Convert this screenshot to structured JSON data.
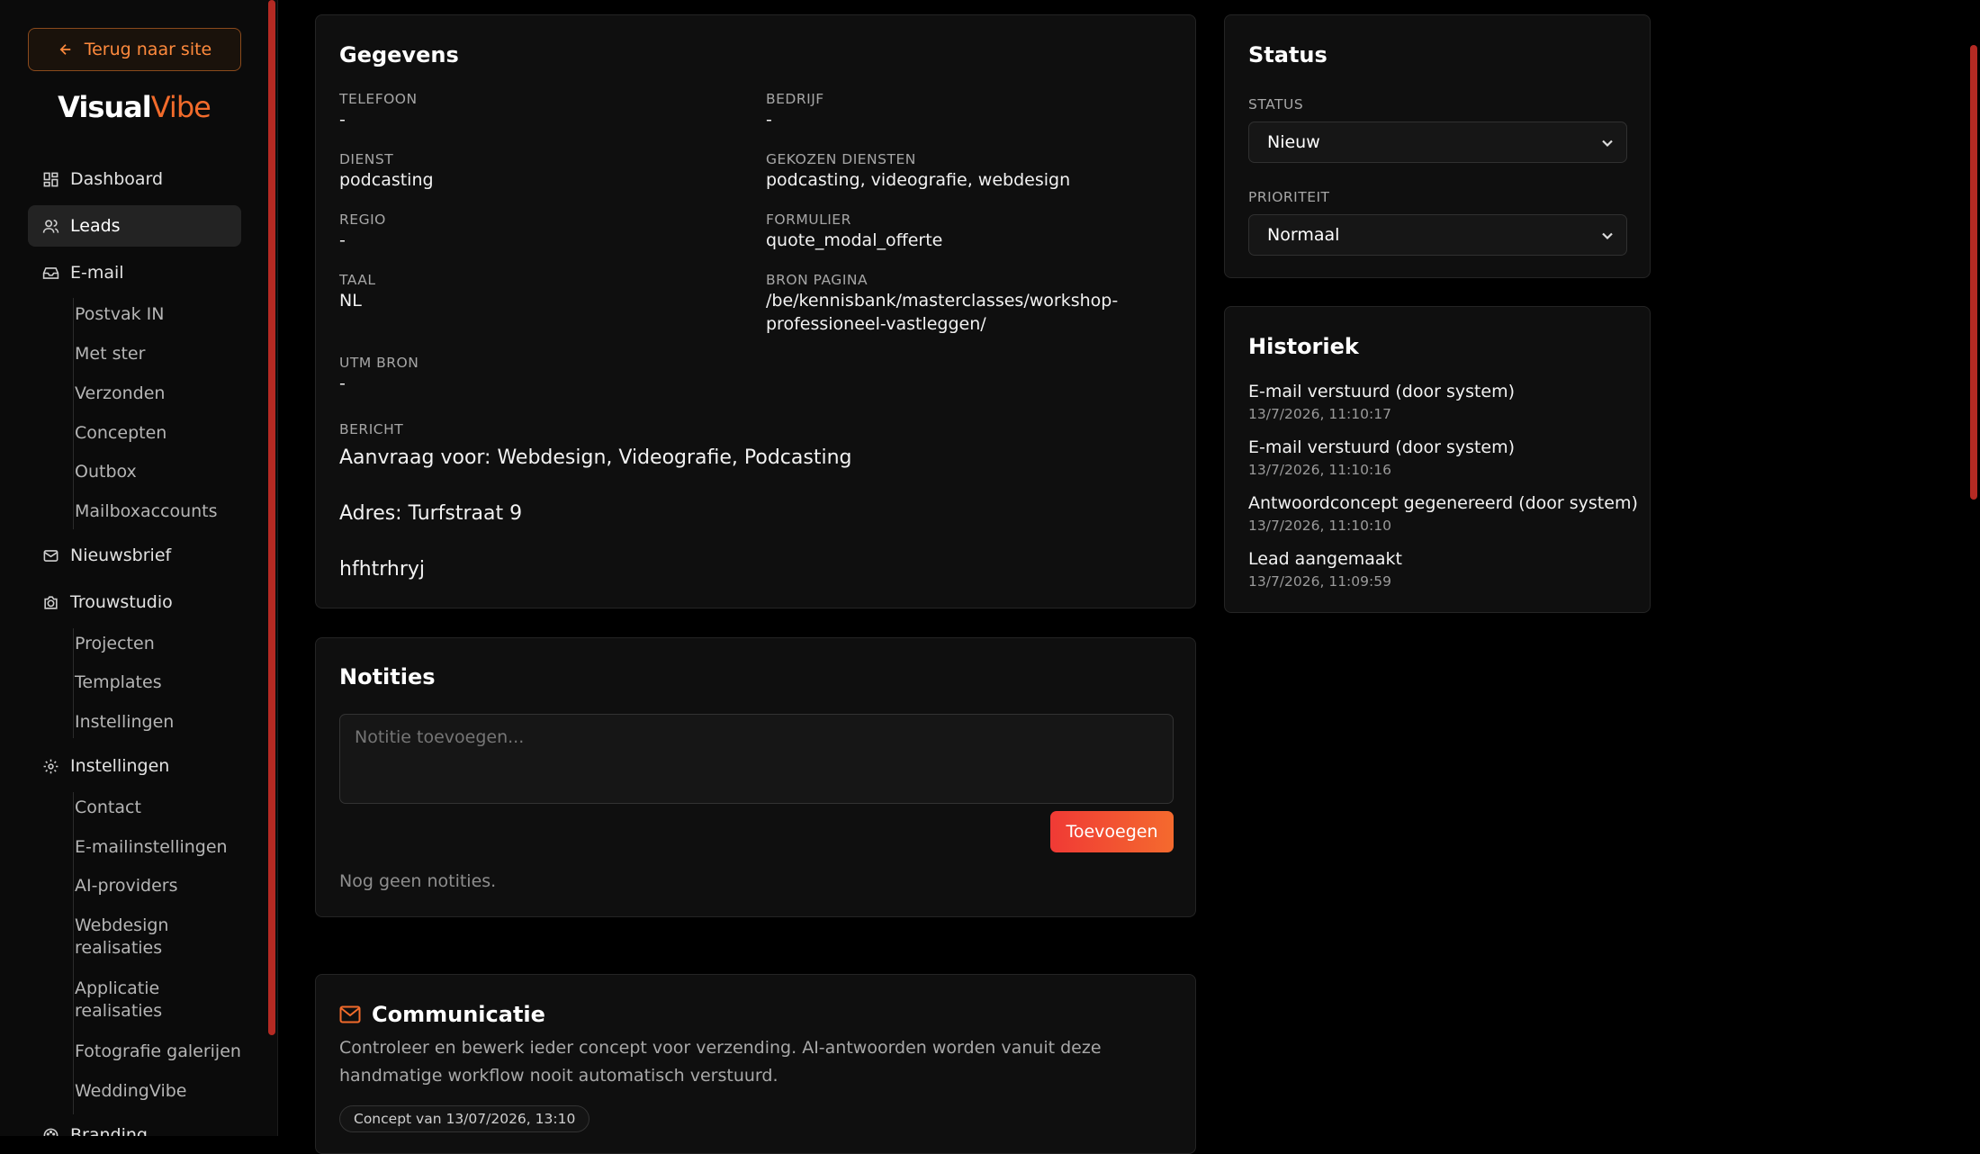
{
  "sidebar": {
    "back_label": "Terug naar site",
    "logo_part1": "Visual",
    "logo_part2": "Vibe",
    "items": [
      {
        "label": "Dashboard",
        "icon": "grid-icon"
      },
      {
        "label": "Leads",
        "icon": "users-icon",
        "active": true
      },
      {
        "label": "E-mail",
        "icon": "inbox-icon"
      },
      {
        "label": "Nieuwsbrief",
        "icon": "mail-icon"
      },
      {
        "label": "Trouwstudio",
        "icon": "camera-icon"
      },
      {
        "label": "Instellingen",
        "icon": "gear-icon"
      },
      {
        "label": "Branding",
        "icon": "palette-icon"
      }
    ],
    "email_sub": [
      "Postvak IN",
      "Met ster",
      "Verzonden",
      "Concepten",
      "Outbox",
      "Mailboxaccounts"
    ],
    "trouw_sub": [
      "Projecten",
      "Templates",
      "Instellingen"
    ],
    "settings_sub": [
      "Contact",
      "E-mailinstellingen",
      "AI-providers",
      "Webdesign realisaties",
      "Applicatie realisaties",
      "Fotografie galerijen",
      "WeddingVibe"
    ]
  },
  "gegevens": {
    "title": "Gegevens",
    "fields": {
      "telefoon_label": "TELEFOON",
      "telefoon": "-",
      "bedrijf_label": "BEDRIJF",
      "bedrijf": "-",
      "dienst_label": "DIENST",
      "dienst": "podcasting",
      "gekozen_label": "GEKOZEN DIENSTEN",
      "gekozen": "podcasting, videografie, webdesign",
      "regio_label": "REGIO",
      "regio": "-",
      "formulier_label": "FORMULIER",
      "formulier": "quote_modal_offerte",
      "taal_label": "TAAL",
      "taal": "NL",
      "bron_label": "BRON PAGINA",
      "bron_line1": "/be/kennisbank/masterclasses/workshop-",
      "bron_line2": "professioneel-vastleggen/",
      "utm_label": "UTM BRON",
      "utm": "-"
    },
    "bericht_label": "BERICHT",
    "bericht": [
      "Aanvraag voor: Webdesign, Videografie, Podcasting",
      "Adres: Turfstraat 9",
      "hfhtrhryj"
    ]
  },
  "notities": {
    "title": "Notities",
    "placeholder": "Notitie toevoegen...",
    "add_label": "Toevoegen",
    "empty": "Nog geen notities."
  },
  "communicatie": {
    "title": "Communicatie",
    "desc_line1": "Controleer en bewerk ieder concept voor verzending. AI-antwoorden worden vanuit deze",
    "desc_line2": "handmatige workflow nooit automatisch verstuurd.",
    "concept_pill": "Concept van 13/07/2026, 13:10"
  },
  "status": {
    "title": "Status",
    "status_label": "STATUS",
    "status_value": "Nieuw",
    "prio_label": "PRIORITEIT",
    "prio_value": "Normaal"
  },
  "historiek": {
    "title": "Historiek",
    "entries": [
      {
        "title": "E-mail verstuurd (door system)",
        "date": "13/7/2026, 11:10:17"
      },
      {
        "title": "E-mail verstuurd (door system)",
        "date": "13/7/2026, 11:10:16"
      },
      {
        "title": "Antwoordconcept gegenereerd (door system)",
        "date": "13/7/2026, 11:10:10"
      },
      {
        "title": "Lead aangemaakt",
        "date": "13/7/2026, 11:09:59"
      }
    ]
  },
  "colors": {
    "accent": "#f26b2b",
    "danger": "#f03a35",
    "scroll": "#b42a23"
  }
}
